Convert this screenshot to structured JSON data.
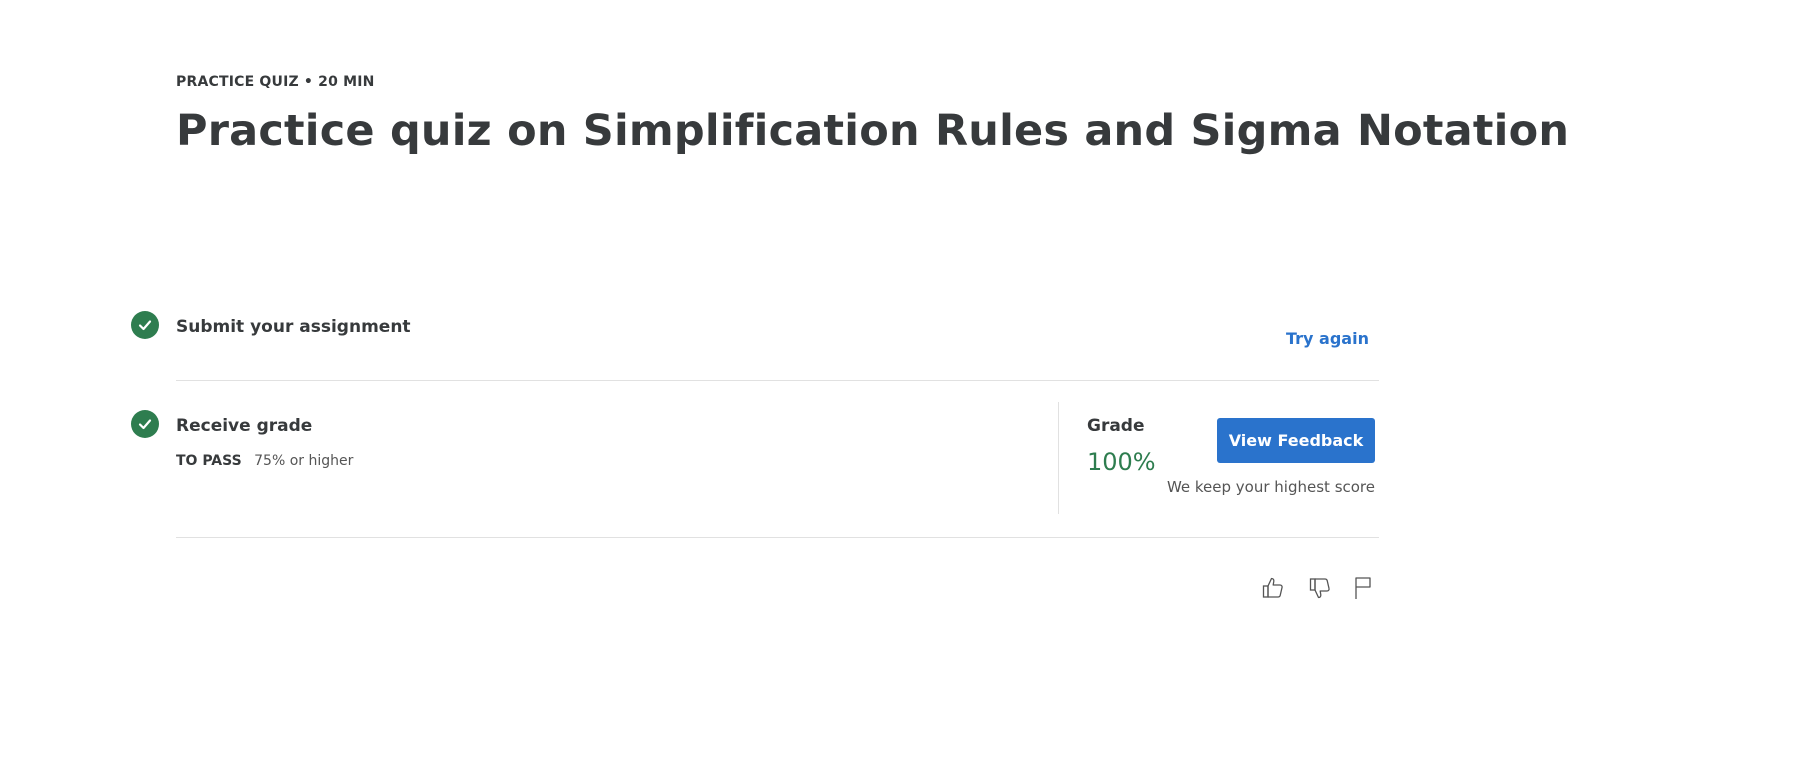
{
  "header": {
    "eyebrow": "PRACTICE QUIZ • 20 MIN",
    "title": "Practice quiz on Simplification Rules and Sigma Notation"
  },
  "steps": {
    "submit": {
      "label": "Submit your assignment",
      "action": "Try again"
    },
    "receive": {
      "label": "Receive grade",
      "pass_label": "TO PASS",
      "pass_value": "75% or higher"
    }
  },
  "grade": {
    "label": "Grade",
    "value": "100%",
    "button": "View Feedback",
    "note": "We keep your highest score"
  },
  "icons": {
    "like": "thumbs-up-icon",
    "dislike": "thumbs-down-icon",
    "report": "flag-icon"
  },
  "colors": {
    "success": "#2e7d4f",
    "accent": "#2a73cc",
    "text": "#373a3c"
  }
}
